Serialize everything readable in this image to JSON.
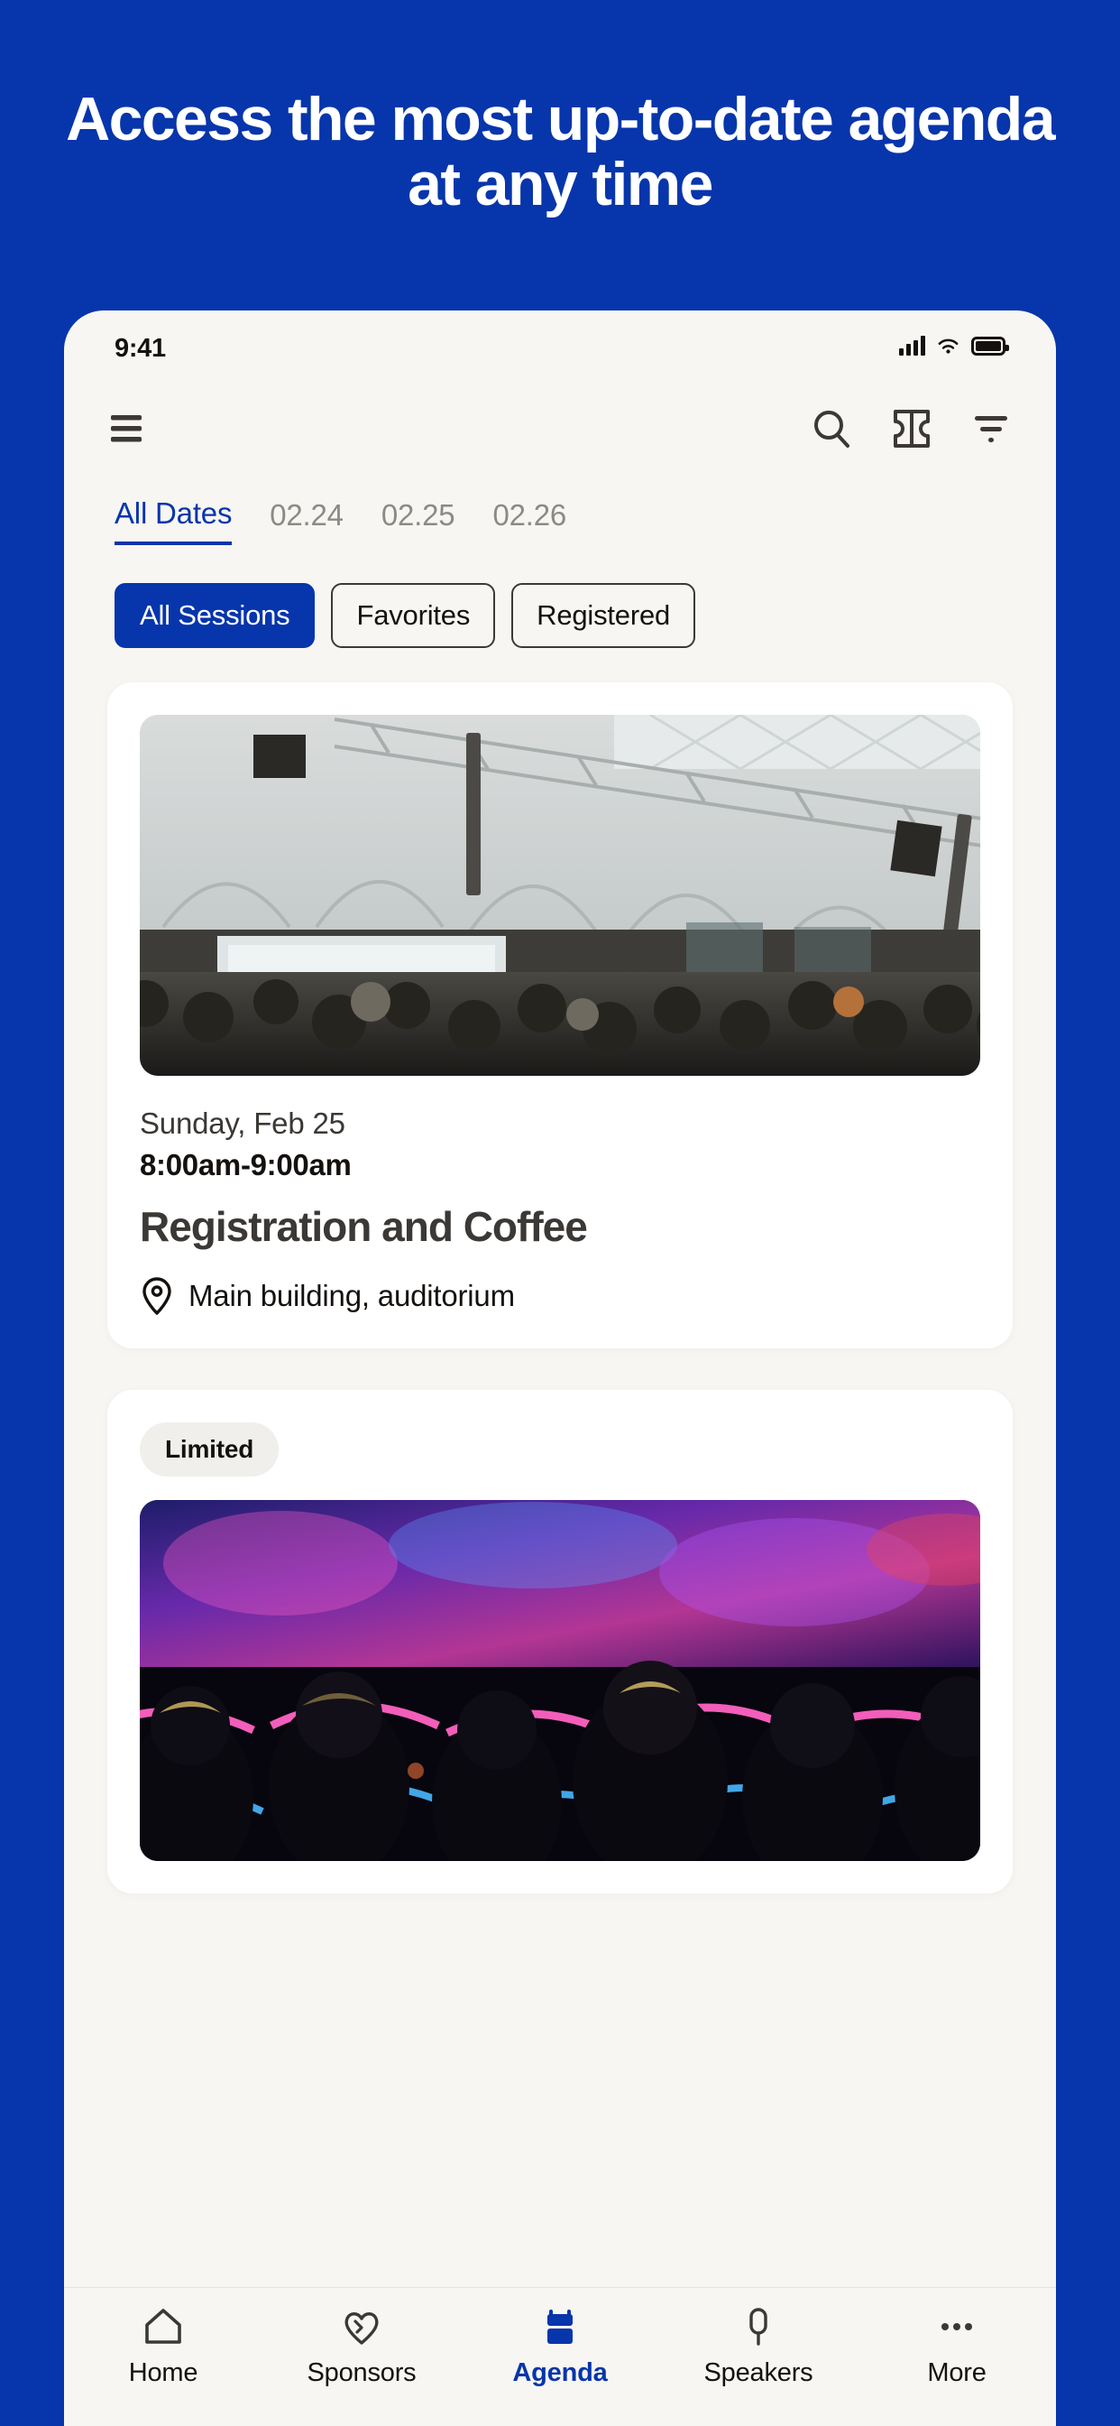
{
  "hero": {
    "title": "Access the most up-to-date agenda at any time",
    "background_color": "#0735ab"
  },
  "phone": {
    "status_bar": {
      "time": "9:41",
      "signal_icon": "cellular-bars-icon",
      "wifi_icon": "wifi-icon",
      "battery_icon": "battery-full-icon"
    },
    "app_header": {
      "menu_icon": "hamburger-menu-icon",
      "search_icon": "search-icon",
      "ticket_icon": "ticket-icon",
      "filter_icon": "filter-icon"
    },
    "date_tabs": [
      {
        "label": "All Dates",
        "active": true
      },
      {
        "label": "02.24",
        "active": false
      },
      {
        "label": "02.25",
        "active": false
      },
      {
        "label": "02.26",
        "active": false
      }
    ],
    "filter_chips": [
      {
        "label": "All Sessions",
        "active": true
      },
      {
        "label": "Favorites",
        "active": false
      },
      {
        "label": "Registered",
        "active": false
      }
    ],
    "sessions": [
      {
        "badge": null,
        "image_alt": "conference-hall-audience-photo",
        "date": "Sunday, Feb 25",
        "time": "8:00am-9:00am",
        "title": "Registration and Coffee",
        "location_icon": "map-pin-icon",
        "location": "Main building, auditorium"
      },
      {
        "badge": "Limited",
        "image_alt": "theater-audience-neon-lights-photo",
        "date": "",
        "time": "",
        "title": "",
        "location_icon": "map-pin-icon",
        "location": ""
      }
    ],
    "bottom_nav": [
      {
        "label": "Home",
        "icon": "home-icon",
        "active": false
      },
      {
        "label": "Sponsors",
        "icon": "heart-handshake-icon",
        "active": false
      },
      {
        "label": "Agenda",
        "icon": "calendar-icon",
        "active": true
      },
      {
        "label": "Speakers",
        "icon": "microphone-icon",
        "active": false
      },
      {
        "label": "More",
        "icon": "ellipsis-icon",
        "active": false
      }
    ]
  },
  "colors": {
    "brand_blue": "#0735ab",
    "app_background": "#f7f6f2",
    "card_background": "#ffffff",
    "text_dark": "#14110f",
    "text_muted": "#8d8a86"
  }
}
